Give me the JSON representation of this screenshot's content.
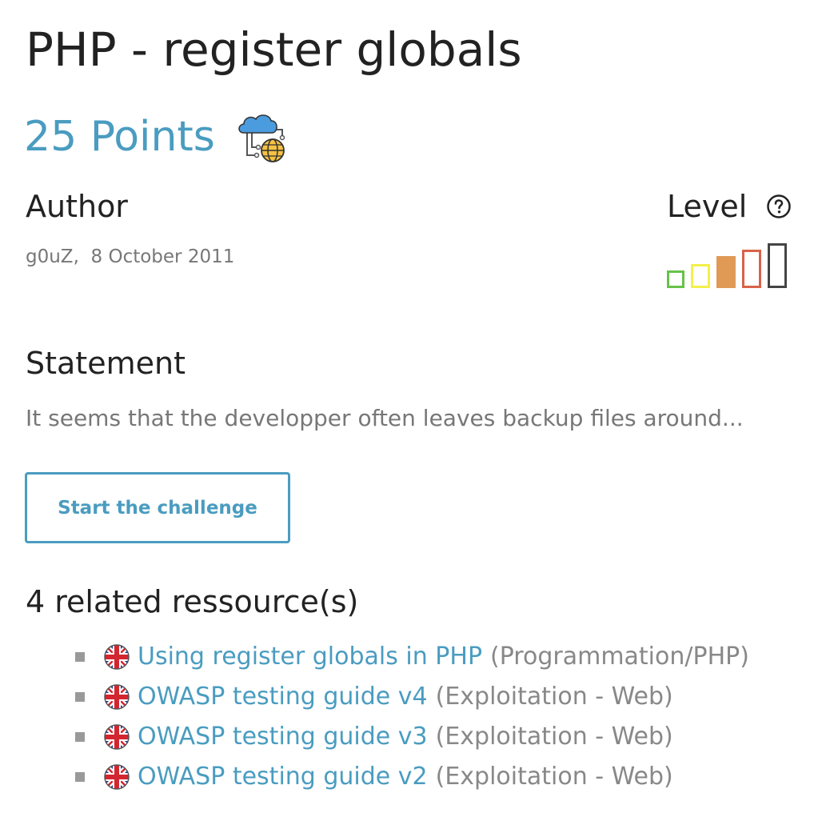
{
  "challenge": {
    "title": "PHP - register globals",
    "points": "25 Points",
    "category_icon": "cloud-network-globe-icon"
  },
  "author": {
    "heading": "Author",
    "name": "g0uZ",
    "separator": ",",
    "date": "8 October 2011"
  },
  "level": {
    "heading": "Level",
    "help_icon": "question-circle-icon",
    "value": 3,
    "max": 5,
    "colors": [
      "#66c24a",
      "#f3f04a",
      "#e09a56",
      "#d9624a",
      "#444444"
    ]
  },
  "statement": {
    "heading": "Statement",
    "text": "It seems that the developper often leaves backup files around..."
  },
  "start_button": {
    "label": "Start the challenge"
  },
  "resources": {
    "heading": "4 related ressource(s)",
    "items": [
      {
        "flag": "uk-flag-icon",
        "title": "Using register globals in PHP",
        "category": "(Programmation/PHP)"
      },
      {
        "flag": "uk-flag-icon",
        "title": "OWASP testing guide v4",
        "category": "(Exploitation - Web)"
      },
      {
        "flag": "uk-flag-icon",
        "title": "OWASP testing guide v3",
        "category": "(Exploitation - Web)"
      },
      {
        "flag": "uk-flag-icon",
        "title": "OWASP testing guide v2",
        "category": "(Exploitation - Web)"
      }
    ]
  },
  "colors": {
    "accent": "#4a9cc0",
    "muted_text": "#777777"
  }
}
